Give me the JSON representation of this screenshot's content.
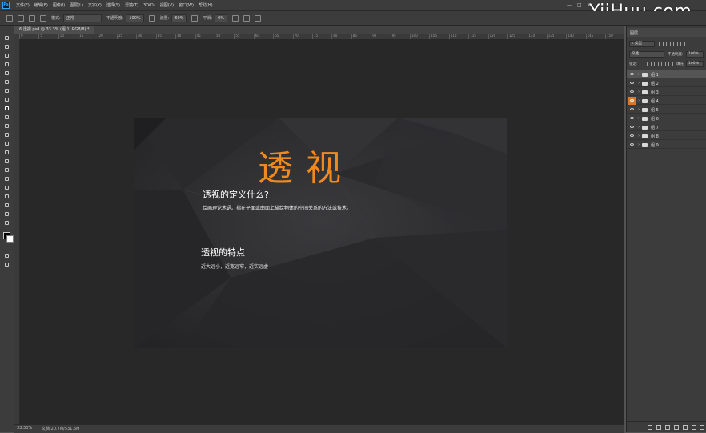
{
  "menubar": {
    "app_icon": "Ps",
    "items": [
      "文件(F)",
      "编辑(E)",
      "图像(I)",
      "图层(L)",
      "文字(Y)",
      "选择(S)",
      "滤镜(T)",
      "3D(D)",
      "视图(V)",
      "窗口(W)",
      "帮助(H)"
    ],
    "window_controls": [
      "—",
      "□",
      "✕"
    ]
  },
  "options_bar": {
    "mode_label": "模式:",
    "mode_value": "正常",
    "opacity_label": "不透明度:",
    "opacity_value": "100%",
    "flow_label": "流量:",
    "flow_value": "60%",
    "smooth_label": "平滑:",
    "smooth_value": "0%"
  },
  "watermark": "YiiHuu.com",
  "document_tab": {
    "label": "6.透视.psd @ 33.3% (组 1, RGB/8) *",
    "close": "×"
  },
  "ruler_numbers": [
    "0",
    "5",
    "10",
    "15",
    "20",
    "25",
    "30",
    "35",
    "40",
    "45",
    "50",
    "55",
    "60",
    "65",
    "70",
    "75",
    "80",
    "85",
    "90",
    "95",
    "100",
    "105",
    "110",
    "115",
    "120",
    "125",
    "130",
    "135",
    "140",
    "145",
    "150"
  ],
  "canvas": {
    "title": "透视",
    "definition_heading": "透视的定义什么?",
    "definition_body": "绘画理论术语。指在平面或曲面上描绘物体的空间关系的方法或技术。",
    "features_heading": "透视的特点",
    "features_body": "近大远小，近宽远窄，近实远虚"
  },
  "statusbar": {
    "zoom": "33.33%",
    "doc": "文档:20.7M/531.6M"
  },
  "layers_panel": {
    "title": "图层",
    "filter_kind": "类型",
    "blend_mode": "穿透",
    "opacity_label": "不透明度:",
    "opacity_value": "100%",
    "lock_label": "锁定:",
    "fill_label": "填充:",
    "fill_value": "100%",
    "layers": [
      {
        "name": "组 1",
        "selected": true,
        "eye_highlight": false
      },
      {
        "name": "组 2",
        "selected": false,
        "eye_highlight": false
      },
      {
        "name": "组 3",
        "selected": false,
        "eye_highlight": false
      },
      {
        "name": "组 4",
        "selected": false,
        "eye_highlight": true
      },
      {
        "name": "组 5",
        "selected": false,
        "eye_highlight": false
      },
      {
        "name": "组 6",
        "selected": false,
        "eye_highlight": false
      },
      {
        "name": "组 7",
        "selected": false,
        "eye_highlight": false
      },
      {
        "name": "组 8",
        "selected": false,
        "eye_highlight": false
      },
      {
        "name": "组 9",
        "selected": false,
        "eye_highlight": false
      }
    ]
  },
  "colors": {
    "title_orange": "#f08a1e",
    "eye_highlight": "#d9782a",
    "workspace": "#282828",
    "panel": "#3c3c3c"
  }
}
